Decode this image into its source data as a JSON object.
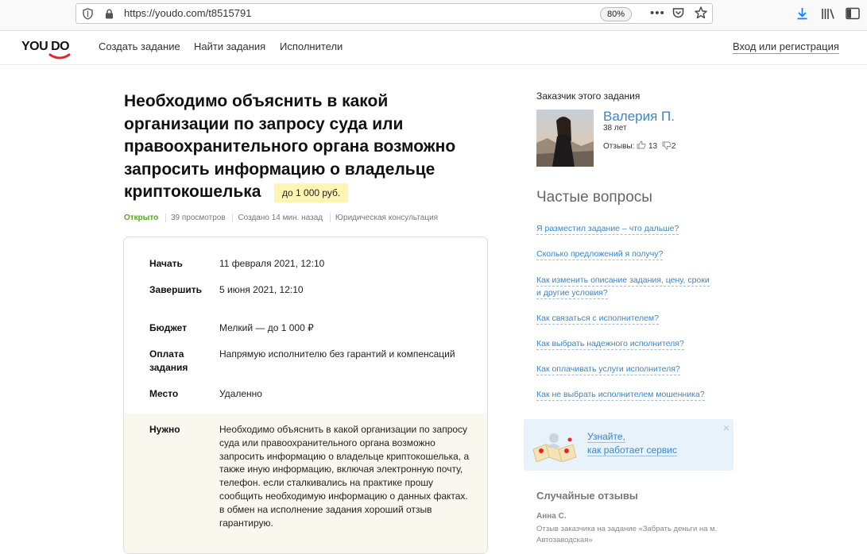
{
  "browser": {
    "url": "https://youdo.com/t8515791",
    "zoom": "80%",
    "menu_dots": "•••",
    "icons": [
      "shield-icon",
      "lock-icon",
      "pocket-icon",
      "star-icon",
      "download-icon",
      "library-icon",
      "sidebar-icon"
    ]
  },
  "header": {
    "logo": "YOU DO",
    "nav": [
      "Создать задание",
      "Найти задания",
      "Исполнители"
    ],
    "login": "Вход или регистрация"
  },
  "task": {
    "title": "Необходимо объяснить в какой организации по запросу суда или правоохранительного органа возможно запросить информацию о владельце криптокошелька",
    "price": "до 1 000 руб.",
    "status": "Открыто",
    "views": "39 просмотров",
    "created": "Создано 14 мин. назад",
    "category": "Юридическая консультация",
    "details": {
      "start_label": "Начать",
      "start_value": "11 февраля 2021, 12:10",
      "end_label": "Завершить",
      "end_value": "5 июня 2021, 12:10",
      "budget_label": "Бюджет",
      "budget_value": "Мелкий — до 1 000 ₽",
      "payment_label_1": "Оплата",
      "payment_label_2": "задания",
      "payment_value": "Напрямую исполнителю без гарантий и компенсаций",
      "place_label": "Место",
      "place_value": "Удаленно",
      "need_label": "Нужно",
      "need_value": "Необходимо объяснить в какой организации по запросу суда или правоохранительного органа возможно запросить информацию о владельце криптокошелька, а также иную информацию, включая электронную почту, телефон. если сталкивались на практике прошу сообщить необходимую информацию о данных фактах. в обмен на исполнение задания хороший отзыв гарантирую."
    }
  },
  "customer": {
    "label": "Заказчик этого задания",
    "name": "Валерия П.",
    "age": "38 лет",
    "reviews_label": "Отзывы:",
    "positive": "13",
    "negative": "2"
  },
  "faq": {
    "title": "Частые вопросы",
    "items": [
      "Я разместил задание – что дальше?",
      "Сколько предложений я получу?",
      "Как изменить описание задания, цену, сроки",
      "и другие условия?",
      "Как связаться с исполнителем?",
      "Как выбрать надежного исполнителя?",
      "Как оплачивать услуги исполнителя?",
      "Как не выбрать исполнителем мошенника?"
    ]
  },
  "info_box": {
    "line1": "Узнайте,",
    "line2": "как работает сервис",
    "close": "×"
  },
  "random_reviews": {
    "title": "Случайные отзывы",
    "author": "Анна С.",
    "text": "Отзыв заказчика на задание «Забрать деньги на м. Автозаводская»"
  },
  "colors": {
    "link": "#3a86c8",
    "status_open": "#5aa22a",
    "price_badge": "#fff5b3",
    "need_bg": "#faf7ee",
    "logo_accent": "#e4262e"
  }
}
